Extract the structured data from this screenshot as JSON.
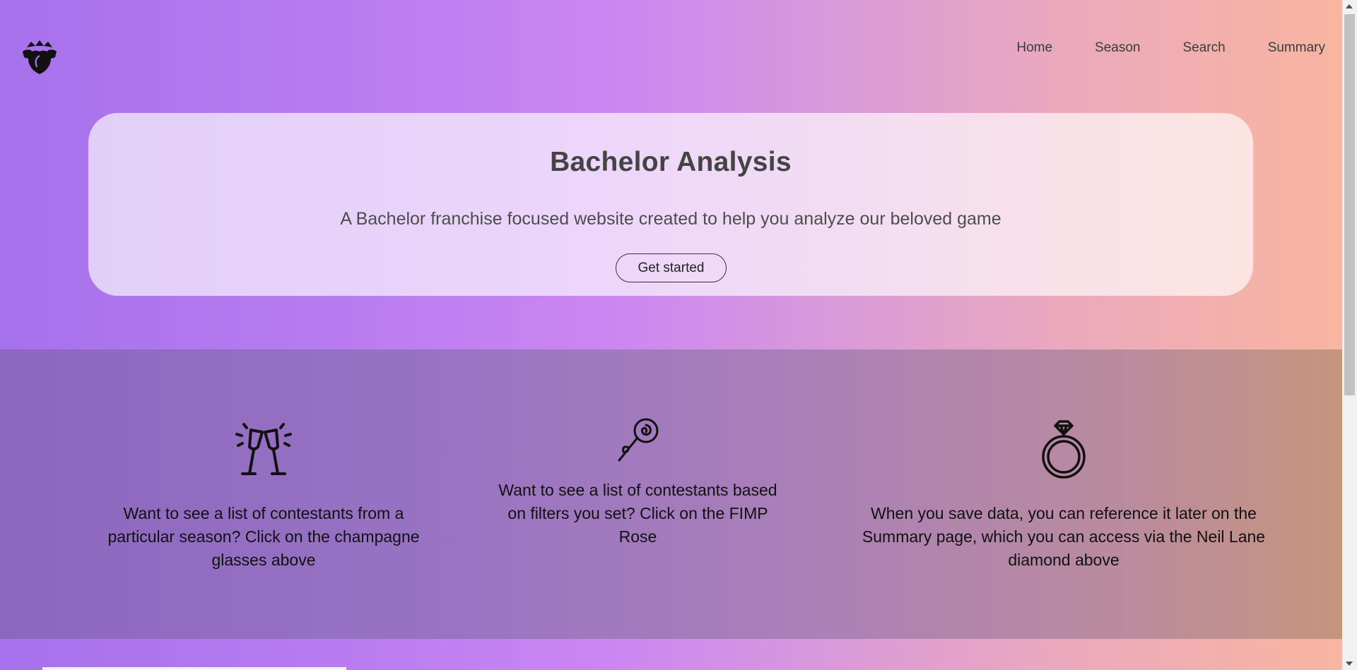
{
  "nav": {
    "logo": "rose-logo",
    "items": [
      "Home",
      "Season",
      "Search",
      "Summary"
    ]
  },
  "hero": {
    "title": "Bachelor Analysis",
    "subtitle": "A Bachelor franchise focused website created to help you analyze our beloved game",
    "cta_label": "Get started"
  },
  "features": [
    {
      "icon": "champagne-glasses-icon",
      "text": "Want to see a list of contestants from a particular season? Click on the champagne glasses above"
    },
    {
      "icon": "rose-icon",
      "text": "Want to see a list of contestants based on filters you set? Click on the FIMP Rose"
    },
    {
      "icon": "diamond-ring-icon",
      "text": "When you save data, you can reference it later on the Summary page, which you can access via the Neil Lane diamond above"
    }
  ],
  "colors": {
    "gradient_left": "#a671ec",
    "gradient_mid": "#cc86f2",
    "gradient_right": "#f9b69f",
    "text_dark": "#444444"
  }
}
